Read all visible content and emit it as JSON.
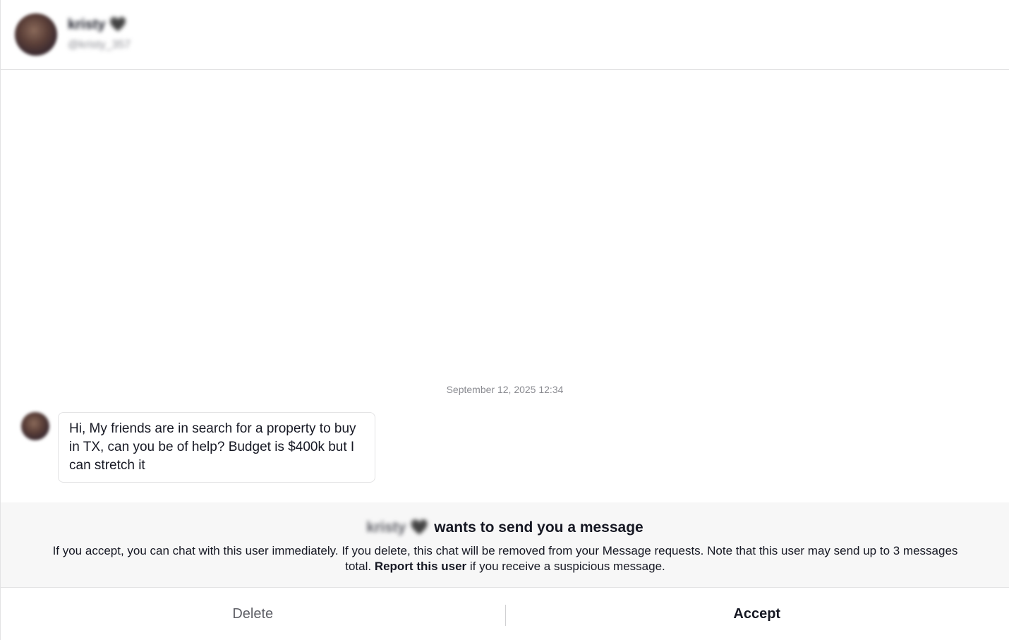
{
  "header": {
    "name": "kristy 🖤",
    "handle": "@kristy_357"
  },
  "conversation": {
    "timestamp": "September 12, 2025 12:34",
    "message_text": "Hi, My friends are in search for a property to buy in TX, can you be of help? Budget is $400k but I can stretch it"
  },
  "request": {
    "sender_name": "kristy 🖤",
    "title_suffix": "wants to send you a message",
    "body_before_link": "If you accept, you can chat with this user immediately. If you delete, this chat will be removed from your Message requests. Note that this user may send up to 3 messages total.",
    "report_link": "Report this user",
    "body_after_link": "if you receive a suspicious message."
  },
  "actions": {
    "delete_label": "Delete",
    "accept_label": "Accept"
  }
}
